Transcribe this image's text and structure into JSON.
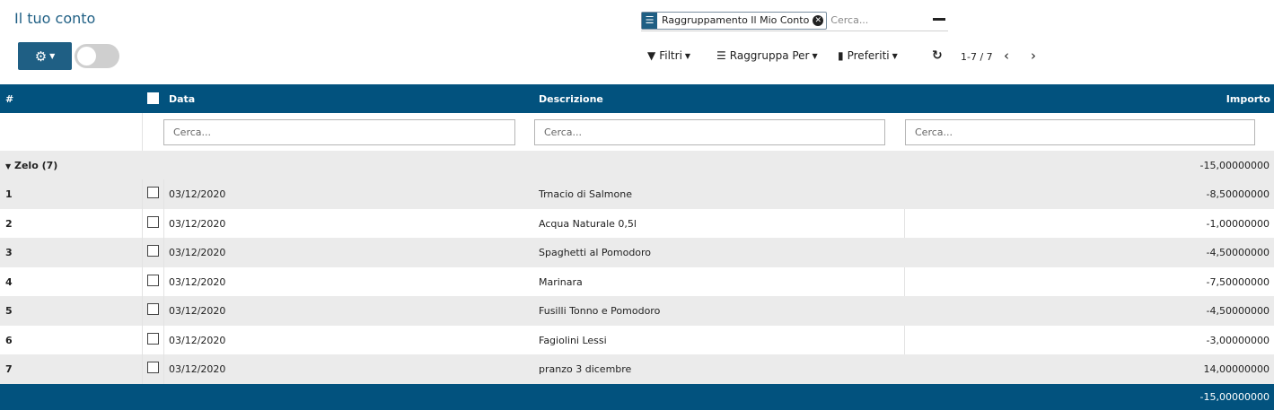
{
  "page": {
    "title": "Il tuo conto"
  },
  "search": {
    "facet_label": "Raggruppamento Il Mio Conto",
    "placeholder": "Cerca..."
  },
  "toolbar": {
    "filters_label": "Filtri",
    "groupby_label": "Raggruppa Per",
    "favorites_label": "Preferiti",
    "pager": "1-7 / 7"
  },
  "table": {
    "columns": {
      "num": "#",
      "date": "Data",
      "description": "Descrizione",
      "amount": "Importo"
    },
    "filter_placeholder": "Cerca...",
    "group": {
      "name": "Zelo (7)",
      "total": "-15,00000000"
    },
    "rows": [
      {
        "num": "1",
        "date": "03/12/2020",
        "description": "Trnacio di Salmone",
        "amount": "-8,50000000"
      },
      {
        "num": "2",
        "date": "03/12/2020",
        "description": "Acqua Naturale 0,5l",
        "amount": "-1,00000000"
      },
      {
        "num": "3",
        "date": "03/12/2020",
        "description": "Spaghetti al Pomodoro",
        "amount": "-4,50000000"
      },
      {
        "num": "4",
        "date": "03/12/2020",
        "description": "Marinara",
        "amount": "-7,50000000"
      },
      {
        "num": "5",
        "date": "03/12/2020",
        "description": "Fusilli Tonno e Pomodoro",
        "amount": "-4,50000000"
      },
      {
        "num": "6",
        "date": "03/12/2020",
        "description": "Fagiolini Lessi",
        "amount": "-3,00000000"
      },
      {
        "num": "7",
        "date": "03/12/2020",
        "description": "pranzo 3 dicembre",
        "amount": "14,00000000"
      }
    ],
    "footer_total": "-15,00000000"
  },
  "colors": {
    "primary": "#02527e",
    "title": "#1f5f84",
    "row_alt": "#ebebeb"
  }
}
